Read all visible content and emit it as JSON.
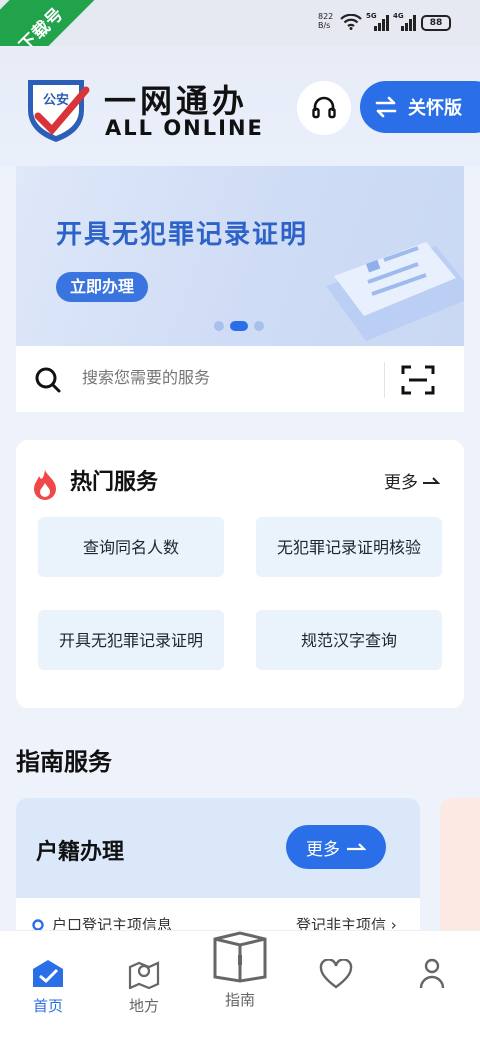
{
  "status_bar": {
    "badge_text": "下载号",
    "net_speed": "822",
    "net_unit": "B/s",
    "signal_1": "5G",
    "signal_2": "4G",
    "battery": "88"
  },
  "header": {
    "logo_text": "公安",
    "title_cn": "一网通办",
    "title_en": "ALL ONLINE",
    "service_icon": "headset-icon",
    "care_icon": "swap-arrows-icon",
    "care_label": "关怀版"
  },
  "banner": {
    "title": "开具无犯罪记录证明",
    "button": "立即办理",
    "page_count": 3,
    "active_page": 2
  },
  "search": {
    "placeholder": "搜索您需要的服务",
    "search_icon": "search-icon",
    "scan_icon": "scan-icon"
  },
  "hot_services": {
    "title": "热门服务",
    "more": "更多",
    "icon": "flame-icon",
    "items": [
      {
        "label": "查询同名人数"
      },
      {
        "label": "无犯罪记录证明核验"
      },
      {
        "label": "开具无犯罪记录证明"
      },
      {
        "label": "规范汉字查询"
      }
    ]
  },
  "guide": {
    "title": "指南服务",
    "card_title": "户籍办理",
    "more": "更多",
    "item_a": "户口登记主项信息",
    "item_b": "登记非主项信"
  },
  "tabbar": {
    "items": [
      {
        "label": "首页",
        "icon": "home-icon"
      },
      {
        "label": "地方",
        "icon": "map-pin-icon"
      },
      {
        "label": "指南",
        "icon": "guide-book-icon"
      },
      {
        "label": "",
        "icon": "heart-icon"
      },
      {
        "label": "",
        "icon": "person-icon"
      }
    ],
    "active": "首页"
  },
  "colors": {
    "primary": "#2b6fe8",
    "page_bg": "#eef2fb",
    "card_tint": "#eaf2fc",
    "flame": "#f04848",
    "badge_green": "#21a34b"
  }
}
